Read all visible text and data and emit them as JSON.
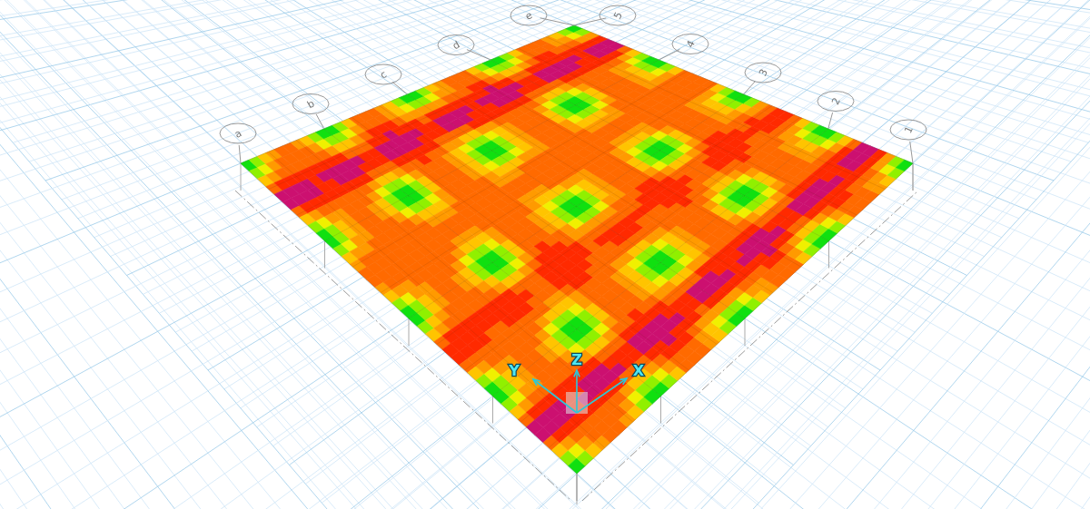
{
  "grid_bubbles_letters": [
    "a",
    "b",
    "c",
    "d",
    "e"
  ],
  "grid_bubbles_numbers": [
    "5",
    "4",
    "3",
    "2",
    "1"
  ],
  "axis_labels": [
    "Y",
    "Z",
    "X"
  ]
}
